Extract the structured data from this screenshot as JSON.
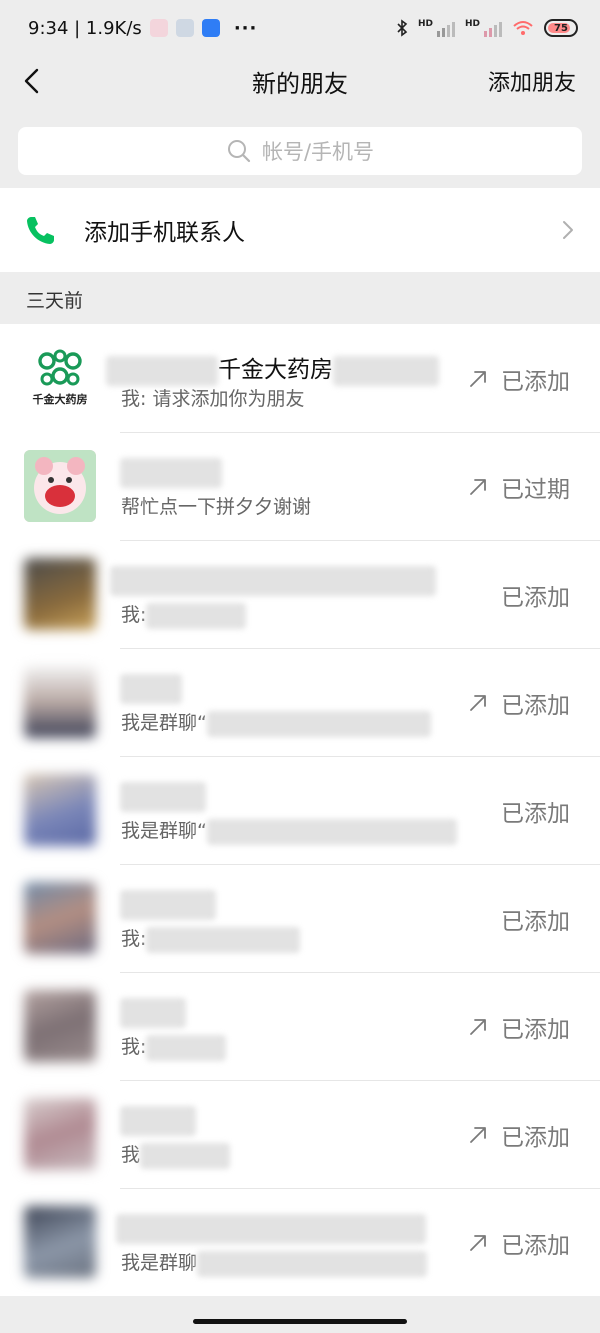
{
  "status_bar": {
    "time_speed": "9:34 | 1.9K/s",
    "dots": "···",
    "battery": "75",
    "signal_label_1": "HD",
    "signal_label_2": "HD"
  },
  "header": {
    "title": "新的朋友",
    "add_friend": "添加朋友"
  },
  "search": {
    "placeholder": "帐号/手机号"
  },
  "phone_contacts": {
    "label": "添加手机联系人"
  },
  "section": {
    "label": "三天前"
  },
  "requests": [
    {
      "name": "千金大药房",
      "message": "我: 请求添加你为朋友",
      "status": "已添加",
      "arrow": true,
      "avatar": "logo",
      "logo_text": "千金大药房"
    },
    {
      "name": "",
      "message": "帮忙点一下拼夕夕谢谢",
      "status": "已过期",
      "arrow": true,
      "avatar": "cartoon"
    },
    {
      "name": "",
      "message": "我:",
      "status": "已添加",
      "arrow": false,
      "avatar": "photo"
    },
    {
      "name": "",
      "message": "我是群聊“",
      "status": "已添加",
      "arrow": true,
      "avatar": "photo"
    },
    {
      "name": "",
      "message": "我是群聊“",
      "status": "已添加",
      "arrow": false,
      "avatar": "photo"
    },
    {
      "name": "",
      "message": "我:",
      "status": "已添加",
      "arrow": false,
      "avatar": "photo"
    },
    {
      "name": "",
      "message": "我:",
      "status": "已添加",
      "arrow": true,
      "avatar": "photo"
    },
    {
      "name": "",
      "message": "我",
      "status": "已添加",
      "arrow": true,
      "avatar": "photo"
    },
    {
      "name": "",
      "message": "我是群聊",
      "status": "已添加",
      "arrow": true,
      "avatar": "photo"
    }
  ],
  "colors": {
    "accent_green": "#07c160",
    "background": "#ededed"
  }
}
